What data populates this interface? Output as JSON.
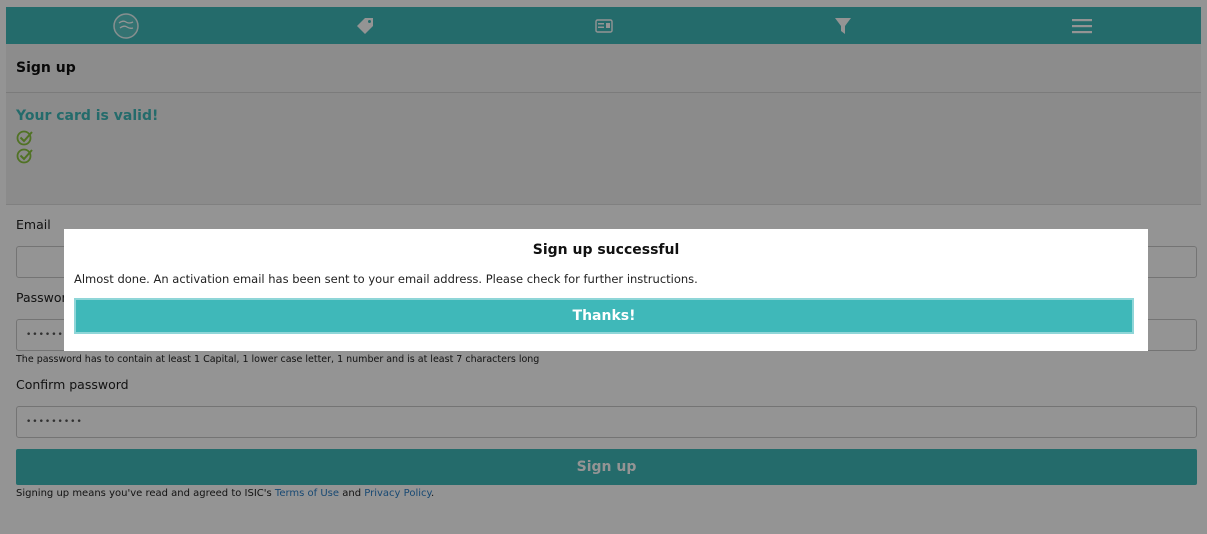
{
  "nav": {
    "icons": [
      "globe-logo-icon",
      "tag-icon",
      "card-icon",
      "filter-icon",
      "menu-icon"
    ]
  },
  "page": {
    "title": "Sign up",
    "valid_message": "Your card is valid!"
  },
  "form": {
    "email_label": "Email",
    "password_label": "Password",
    "password_value": "•••••••••",
    "password_hint": "The password has to contain at least 1 Capital, 1 lower case letter, 1 number and is at least 7 characters long",
    "confirm_label": "Confirm password",
    "confirm_value": "•••••••••",
    "signup_button": "Sign up",
    "terms_prefix": "Signing up means you've read and agreed to ISIC's",
    "terms_link": "Terms of Use",
    "terms_and": "and",
    "privacy_link": "Privacy Policy",
    "terms_suffix": "."
  },
  "modal": {
    "title": "Sign up successful",
    "message": "Almost done. An activation email has been sent to your email address. Please check for further instructions.",
    "button": "Thanks!"
  },
  "colors": {
    "accent": "#3fb8b9",
    "check": "#8ac43f",
    "link": "#2a7ec6"
  }
}
